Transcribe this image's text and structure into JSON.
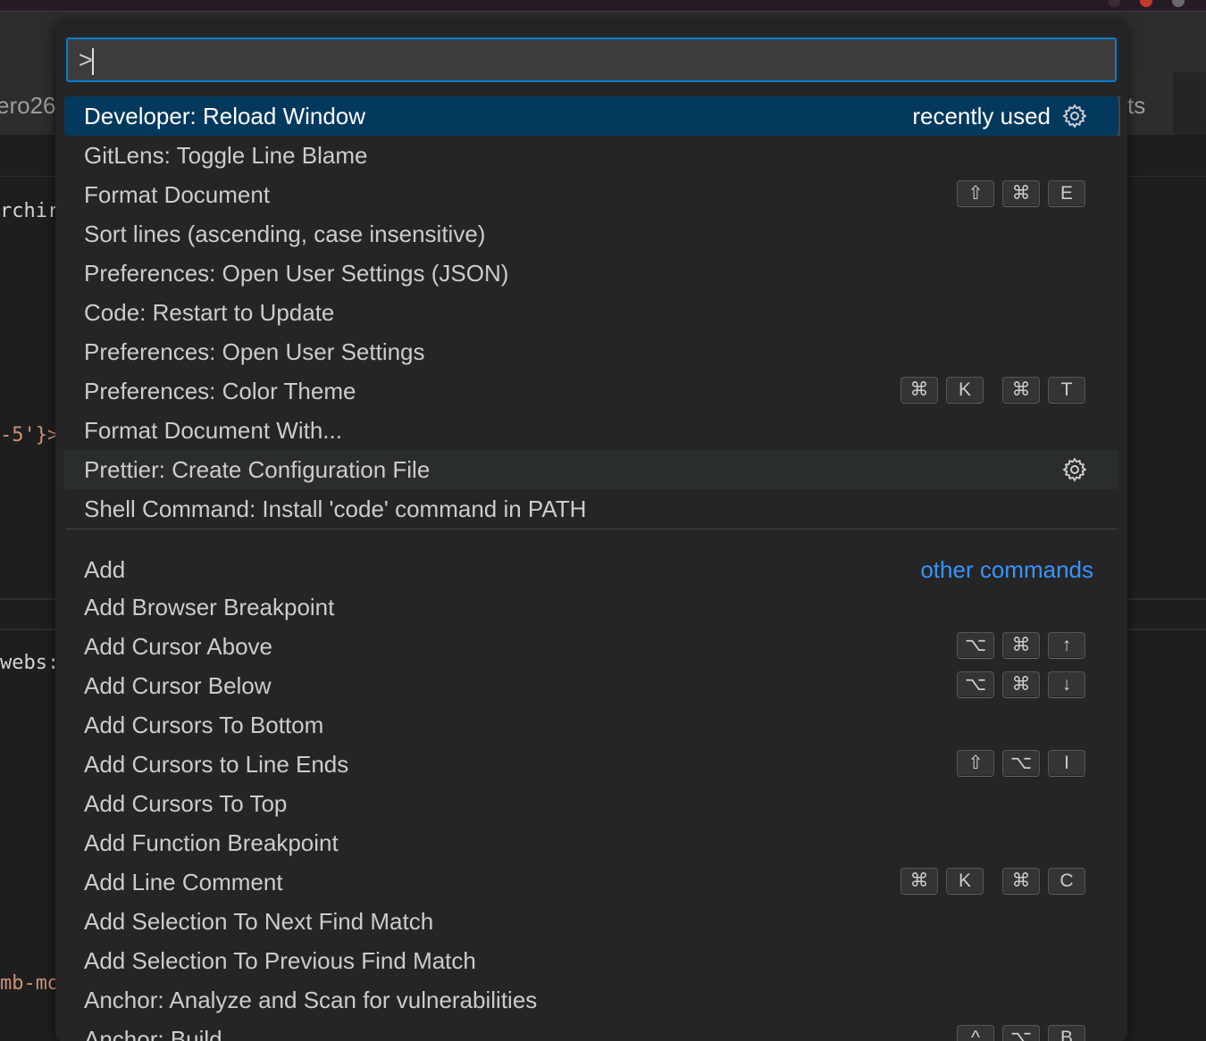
{
  "background": {
    "tab_left_text": "ero26",
    "tab_right_text": "ts",
    "code_fragments": [
      "rchir",
      "-5'}>",
      "webs:",
      "mb-mo"
    ]
  },
  "palette": {
    "input_value": ">",
    "selected_row": 0,
    "hover_row": 9,
    "rows": [
      {
        "label": "Developer: Reload Window",
        "tag": "recently used",
        "gear": true
      },
      {
        "label": "GitLens: Toggle Line Blame"
      },
      {
        "label": "Format Document",
        "keys": [
          [
            "⇧",
            "⌘",
            "E"
          ]
        ]
      },
      {
        "label": "Sort lines (ascending, case insensitive)"
      },
      {
        "label": "Preferences: Open User Settings (JSON)"
      },
      {
        "label": "Code: Restart to Update"
      },
      {
        "label": "Preferences: Open User Settings"
      },
      {
        "label": "Preferences: Color Theme",
        "keys": [
          [
            "⌘",
            "K"
          ],
          [
            "⌘",
            "T"
          ]
        ]
      },
      {
        "label": "Format Document With..."
      },
      {
        "label": "Prettier: Create Configuration File",
        "gear": true
      },
      {
        "label": "Shell Command: Install 'code' command in PATH"
      },
      {
        "label": "Add",
        "tag": "other commands",
        "tag_color": "blue"
      },
      {
        "label": "Add Browser Breakpoint"
      },
      {
        "label": "Add Cursor Above",
        "keys": [
          [
            "⌥",
            "⌘",
            "↑"
          ]
        ]
      },
      {
        "label": "Add Cursor Below",
        "keys": [
          [
            "⌥",
            "⌘",
            "↓"
          ]
        ]
      },
      {
        "label": "Add Cursors To Bottom"
      },
      {
        "label": "Add Cursors to Line Ends",
        "keys": [
          [
            "⇧",
            "⌥",
            "I"
          ]
        ]
      },
      {
        "label": "Add Cursors To Top"
      },
      {
        "label": "Add Function Breakpoint"
      },
      {
        "label": "Add Line Comment",
        "keys": [
          [
            "⌘",
            "K"
          ],
          [
            "⌘",
            "C"
          ]
        ]
      },
      {
        "label": "Add Selection To Next Find Match"
      },
      {
        "label": "Add Selection To Previous Find Match"
      },
      {
        "label": "Anchor: Analyze and Scan for vulnerabilities"
      },
      {
        "label": "Anchor: Build",
        "keys": [
          [
            "^",
            "⌥",
            "B"
          ]
        ]
      }
    ]
  },
  "colors": {
    "accent": "#007fd4",
    "selected_bg": "#04395e",
    "link_blue": "#3794ff"
  }
}
